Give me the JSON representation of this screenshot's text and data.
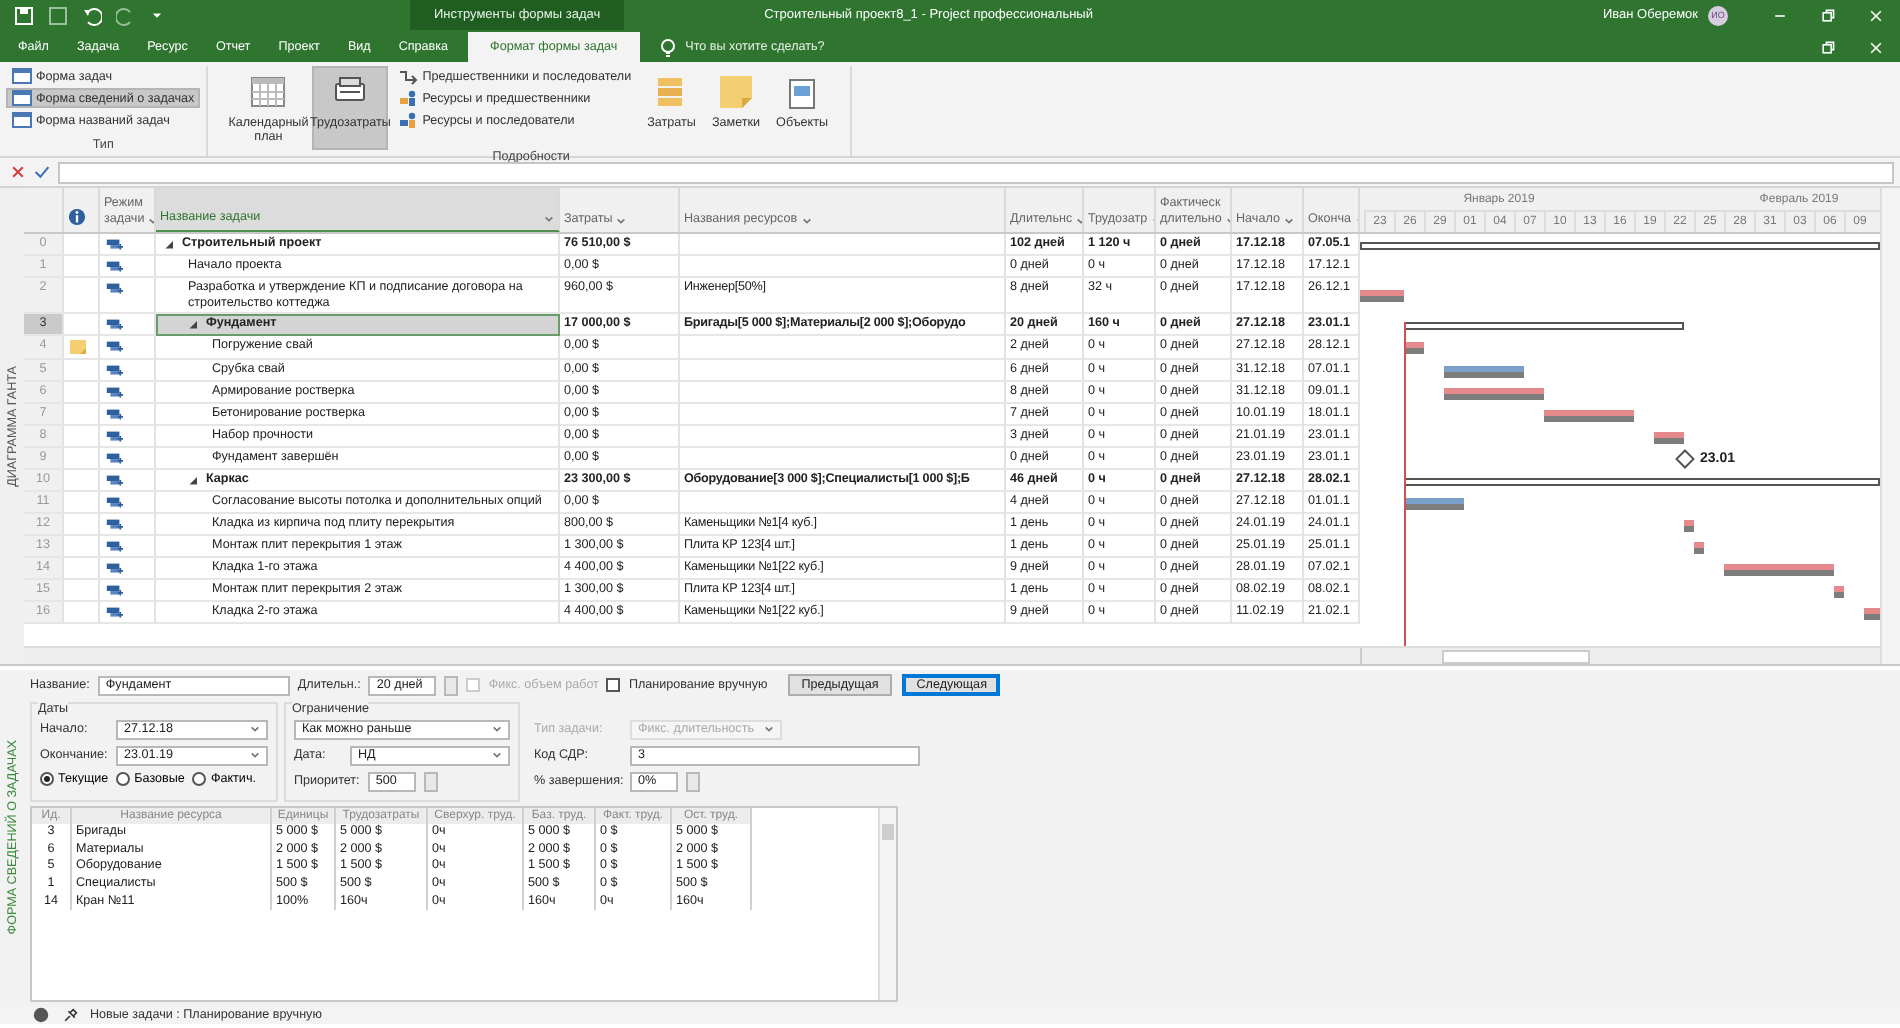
{
  "window": {
    "title": "Строительный проект8_1 - Project профессиональный",
    "context_label": "Инструменты формы задач",
    "user": "Иван Оберемок",
    "avatar": "ИО"
  },
  "tabs": [
    {
      "label": "Файл",
      "selected": false
    },
    {
      "label": "Задача",
      "selected": false
    },
    {
      "label": "Ресурс",
      "selected": false
    },
    {
      "label": "Отчет",
      "selected": false
    },
    {
      "label": "Проект",
      "selected": false
    },
    {
      "label": "Вид",
      "selected": false
    },
    {
      "label": "Справка",
      "selected": false
    },
    {
      "label": "Формат формы задач",
      "selected": true
    }
  ],
  "tell_me": {
    "placeholder": "Что вы хотите сделать?"
  },
  "ribbon": {
    "type_group": {
      "label": "Тип",
      "items": [
        {
          "label": "Форма задач",
          "selected": false
        },
        {
          "label": "Форма сведений о задачах",
          "selected": true
        },
        {
          "label": "Форма названий задач",
          "selected": false
        }
      ]
    },
    "details_group": {
      "label": "Подробности",
      "large": [
        {
          "label": "Календарный план",
          "selected": false
        },
        {
          "label": "Трудозатраты",
          "selected": true
        }
      ],
      "small": [
        "Предшественники и последователи",
        "Ресурсы и предшественники",
        "Ресурсы и последователи"
      ],
      "extra": [
        "Затраты",
        "Заметки",
        "Объекты"
      ]
    }
  },
  "view_label": "ДИАГРАММА ГАНТА",
  "columns": [
    "Режим задачи",
    "Название задачи",
    "Затраты",
    "Названия ресурсов",
    "Длительнс",
    "Трудозатр",
    "Фактическ длительно",
    "Начало",
    "Оконча"
  ],
  "tasks": [
    {
      "id": "0",
      "name": "Строительный проект",
      "kind": "summary",
      "expanded": true,
      "note": false,
      "selected": false,
      "cost": "76 510,00 $",
      "duration": "102 дней",
      "work": "1 120 ч",
      "actual_duration": "0 дней",
      "start": "17.12.18",
      "finish": "07.05.1",
      "children": [
        {
          "id": "1",
          "name": "Начало проекта",
          "kind": "milestone",
          "note": false,
          "selected": false,
          "cost": "0,00 $",
          "duration": "0 дней",
          "work": "0 ч",
          "actual_duration": "0 дней",
          "start": "17.12.18",
          "finish": "17.12.1"
        },
        {
          "id": "2",
          "name": "Разработка и утверждение КП и подписание договора на строительство коттеджа",
          "kind": "task",
          "critical": true,
          "note": false,
          "selected": false,
          "cost": "960,00 $",
          "resources": "Инженер[50%]",
          "duration": "8 дней",
          "work": "32 ч",
          "actual_duration": "0 дней",
          "start": "17.12.18",
          "finish": "26.12.1"
        },
        {
          "id": "3",
          "name": "Фундамент",
          "kind": "summary",
          "expanded": true,
          "note": false,
          "selected": true,
          "cost": "17 000,00 $",
          "resources": "Бригады[5 000 $];Материалы[2 000 $];Оборудо",
          "duration": "20 дней",
          "work": "160 ч",
          "actual_duration": "0 дней",
          "start": "27.12.18",
          "finish": "23.01.1",
          "children": [
            {
              "id": "4",
              "name": "Погружение свай",
              "kind": "task",
              "critical": true,
              "note": true,
              "selected": false,
              "cost": "0,00 $",
              "duration": "2 дней",
              "work": "0 ч",
              "actual_duration": "0 дней",
              "start": "27.12.18",
              "finish": "28.12.1"
            },
            {
              "id": "5",
              "name": "Срубка свай",
              "kind": "task",
              "critical": false,
              "note": false,
              "selected": false,
              "cost": "0,00 $",
              "duration": "6 дней",
              "work": "0 ч",
              "actual_duration": "0 дней",
              "start": "31.12.18",
              "finish": "07.01.1"
            },
            {
              "id": "6",
              "name": "Армирование ростверка",
              "kind": "task",
              "critical": true,
              "note": false,
              "selected": false,
              "cost": "0,00 $",
              "duration": "8 дней",
              "work": "0 ч",
              "actual_duration": "0 дней",
              "start": "31.12.18",
              "finish": "09.01.1"
            },
            {
              "id": "7",
              "name": "Бетонирование ростверка",
              "kind": "task",
              "critical": true,
              "note": false,
              "selected": false,
              "cost": "0,00 $",
              "duration": "7 дней",
              "work": "0 ч",
              "actual_duration": "0 дней",
              "start": "10.01.19",
              "finish": "18.01.1"
            },
            {
              "id": "8",
              "name": "Набор прочности",
              "kind": "task",
              "critical": true,
              "note": false,
              "selected": false,
              "cost": "0,00 $",
              "duration": "3 дней",
              "work": "0 ч",
              "actual_duration": "0 дней",
              "start": "21.01.19",
              "finish": "23.01.1"
            },
            {
              "id": "9",
              "name": "Фундамент завершён",
              "kind": "milestone",
              "note": false,
              "selected": false,
              "cost": "0,00 $",
              "duration": "0 дней",
              "work": "0 ч",
              "actual_duration": "0 дней",
              "start": "23.01.19",
              "finish": "23.01.1",
              "gantt_label": "23.01"
            }
          ]
        },
        {
          "id": "10",
          "name": "Каркас",
          "kind": "summary",
          "expanded": true,
          "note": false,
          "selected": false,
          "cost": "23 300,00 $",
          "resources": "Оборудование[3 000 $];Специалисты[1 000 $];Б",
          "duration": "46 дней",
          "work": "0 ч",
          "actual_duration": "0 дней",
          "start": "27.12.18",
          "finish": "28.02.1",
          "children": [
            {
              "id": "11",
              "name": "Согласование высоты потолка и дополнительных опций",
              "kind": "task",
              "critical": false,
              "note": false,
              "selected": false,
              "cost": "0,00 $",
              "duration": "4 дней",
              "work": "0 ч",
              "actual_duration": "0 дней",
              "start": "27.12.18",
              "finish": "01.01.1"
            },
            {
              "id": "12",
              "name": "Кладка из кирпича под плиту перекрытия",
              "kind": "task",
              "critical": true,
              "note": false,
              "selected": false,
              "cost": "800,00 $",
              "resources": "Каменьщики №1[4 куб.]",
              "duration": "1 день",
              "work": "0 ч",
              "actual_duration": "0 дней",
              "start": "24.01.19",
              "finish": "24.01.1"
            },
            {
              "id": "13",
              "name": "Монтаж плит перекрытия 1 этаж",
              "kind": "task",
              "critical": true,
              "note": false,
              "selected": false,
              "cost": "1 300,00 $",
              "resources": "Плита КР 123[4 шт.]",
              "duration": "1 день",
              "work": "0 ч",
              "actual_duration": "0 дней",
              "start": "25.01.19",
              "finish": "25.01.1"
            },
            {
              "id": "14",
              "name": "Кладка 1-го этажа",
              "kind": "task",
              "critical": true,
              "note": false,
              "selected": false,
              "cost": "4 400,00 $",
              "resources": "Каменьщики №1[22 куб.]",
              "duration": "9 дней",
              "work": "0 ч",
              "actual_duration": "0 дней",
              "start": "28.01.19",
              "finish": "07.02.1"
            },
            {
              "id": "15",
              "name": "Монтаж плит перекрытия 2 этаж",
              "kind": "task",
              "critical": true,
              "note": false,
              "selected": false,
              "cost": "1 300,00 $",
              "resources": "Плита КР 123[4 шт.]",
              "duration": "1 день",
              "work": "0 ч",
              "actual_duration": "0 дней",
              "start": "08.02.19",
              "finish": "08.02.1"
            },
            {
              "id": "16",
              "name": "Кладка 2-го этажа",
              "kind": "task",
              "critical": true,
              "note": false,
              "selected": false,
              "cost": "4 400,00 $",
              "resources": "Каменьщики №1[22 куб.]",
              "duration": "9 дней",
              "work": "0 ч",
              "actual_duration": "0 дней",
              "start": "11.02.19",
              "finish": "21.02.1"
            }
          ]
        }
      ]
    }
  ],
  "gantt": {
    "months": [
      "Январь 2019",
      "Февраль 2019"
    ],
    "days": [
      "23",
      "26",
      "29",
      "01",
      "04",
      "07",
      "10",
      "13",
      "16",
      "19",
      "22",
      "25",
      "28",
      "31",
      "03",
      "06",
      "09"
    ]
  },
  "task_form": {
    "title": "ФОРМА СВЕДЕНИЙ О ЗАДАЧАХ",
    "name_label": "Название:",
    "name": "Фундамент",
    "duration_label": "Длительн.:",
    "duration": "20 дней",
    "fixed_work": {
      "label": "Фикс. объем работ",
      "checked": false,
      "disabled": true
    },
    "manual": {
      "label": "Планирование вручную",
      "checked": false
    },
    "buttons": [
      {
        "label": "Предыдущая",
        "focused": false
      },
      {
        "label": "Следующая",
        "focused": true
      }
    ],
    "dates": {
      "title": "Даты",
      "start_label": "Начало:",
      "start": "27.12.18",
      "finish_label": "Окончание:",
      "finish": "23.01.19",
      "modes": [
        {
          "label": "Текущие",
          "selected": true
        },
        {
          "label": "Базовые",
          "selected": false
        },
        {
          "label": "Фактич.",
          "selected": false
        }
      ]
    },
    "constraint": {
      "title": "Ограничение",
      "type": "Как можно раньше",
      "date_label": "Дата:",
      "date": "НД",
      "priority_label": "Приоритет:",
      "priority": "500"
    },
    "task_type_label": "Тип задачи:",
    "task_type": "Фикс. длительность",
    "wbs_label": "Код СДР:",
    "wbs": "3",
    "complete_label": "% завершения:",
    "complete": "0%",
    "resources": {
      "columns": [
        "Ид.",
        "Название ресурса",
        "Единицы",
        "Трудозатраты",
        "Сверхур. труд.",
        "Баз. труд.",
        "Факт. труд.",
        "Ост. труд."
      ],
      "rows": [
        [
          "3",
          "Бригады",
          "5 000 $",
          "5 000 $",
          "0ч",
          "5 000 $",
          "0 $",
          "5 000 $"
        ],
        [
          "6",
          "Материалы",
          "2 000 $",
          "2 000 $",
          "0ч",
          "2 000 $",
          "0 $",
          "2 000 $"
        ],
        [
          "5",
          "Оборудование",
          "1 500 $",
          "1 500 $",
          "0ч",
          "1 500 $",
          "0 $",
          "1 500 $"
        ],
        [
          "1",
          "Специалисты",
          "500 $",
          "500 $",
          "0ч",
          "500 $",
          "0 $",
          "500 $"
        ],
        [
          "14",
          "Кран №11",
          "100%",
          "160ч",
          "0ч",
          "160ч",
          "0ч",
          "160ч"
        ]
      ]
    }
  },
  "status_bar": {
    "text": "Новые задачи : Планирование вручную"
  }
}
